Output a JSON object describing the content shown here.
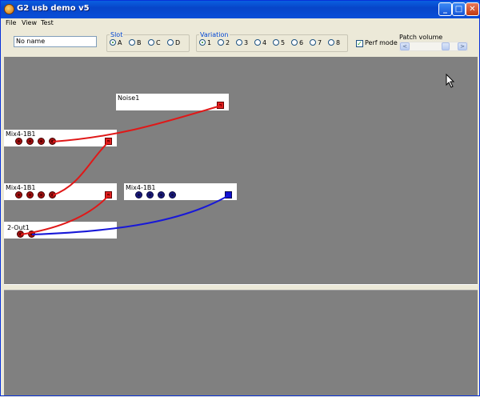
{
  "window": {
    "title": "G2 usb demo v5"
  },
  "menu": {
    "items": [
      "File",
      "View",
      "Test"
    ]
  },
  "toolbar": {
    "patch_name": "No name",
    "slot": {
      "label": "Slot",
      "options": [
        "A",
        "B",
        "C",
        "D"
      ],
      "selected": "A"
    },
    "variation": {
      "label": "Variation",
      "options": [
        "1",
        "2",
        "3",
        "4",
        "5",
        "6",
        "7",
        "8"
      ],
      "selected": "1"
    },
    "perf_mode": {
      "label": "Perf mode",
      "checked": true
    },
    "patch_volume": {
      "label": "Patch volume"
    }
  },
  "modules": [
    {
      "id": "noise1",
      "label": "Noise1"
    },
    {
      "id": "mix_a",
      "label": "Mix4-1B1"
    },
    {
      "id": "mix_b",
      "label": "Mix4-1B1"
    },
    {
      "id": "mix_c",
      "label": "Mix4-1B1"
    },
    {
      "id": "out",
      "label": "2-Out1"
    }
  ],
  "colors": {
    "cable_red": "#e01818",
    "cable_blue": "#1818d8",
    "canvas": "#808080"
  },
  "icons": {
    "minimize": "minimize-icon",
    "maximize": "maximize-icon",
    "close": "close-icon",
    "scroll_left": "arrow-left-icon",
    "scroll_right": "arrow-right-icon"
  }
}
